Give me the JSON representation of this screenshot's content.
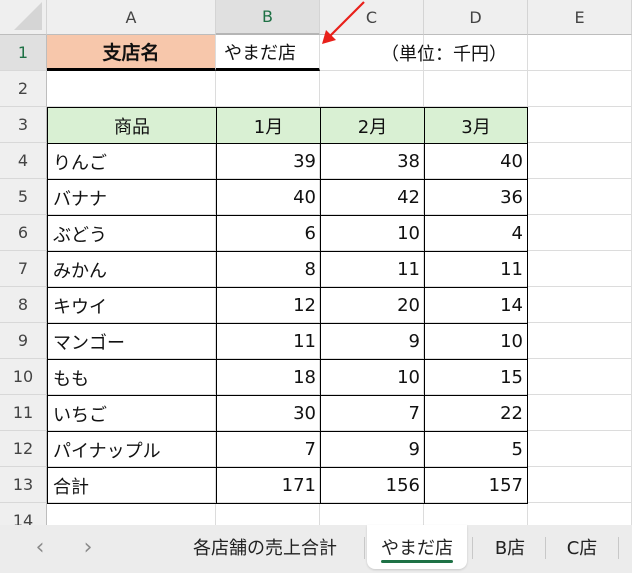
{
  "columns": [
    {
      "label": "A",
      "selected": false
    },
    {
      "label": "B",
      "selected": true
    },
    {
      "label": "C",
      "selected": false
    },
    {
      "label": "D",
      "selected": false
    },
    {
      "label": "E",
      "selected": false
    }
  ],
  "rows": [
    "1",
    "2",
    "3",
    "4",
    "5",
    "6",
    "7",
    "8",
    "9",
    "10",
    "11",
    "12",
    "13",
    "14"
  ],
  "selected_row": "1",
  "branch_label": "支店名",
  "branch_value": "やまだ店",
  "unit_note": "（単位：千円）",
  "table": {
    "headers": [
      "商品",
      "1月",
      "2月",
      "3月"
    ],
    "rows": [
      {
        "product": "りんご",
        "jan": "39",
        "feb": "38",
        "mar": "40"
      },
      {
        "product": "バナナ",
        "jan": "40",
        "feb": "42",
        "mar": "36"
      },
      {
        "product": "ぶどう",
        "jan": "6",
        "feb": "10",
        "mar": "4"
      },
      {
        "product": "みかん",
        "jan": "8",
        "feb": "11",
        "mar": "11"
      },
      {
        "product": "キウイ",
        "jan": "12",
        "feb": "20",
        "mar": "14"
      },
      {
        "product": "マンゴー",
        "jan": "11",
        "feb": "9",
        "mar": "10"
      },
      {
        "product": "もも",
        "jan": "18",
        "feb": "10",
        "mar": "15"
      },
      {
        "product": "いちご",
        "jan": "30",
        "feb": "7",
        "mar": "22"
      },
      {
        "product": "パイナップル",
        "jan": "7",
        "feb": "9",
        "mar": "5"
      },
      {
        "product": "合計",
        "jan": "171",
        "feb": "156",
        "mar": "157"
      }
    ]
  },
  "annotation": {
    "type": "arrow",
    "color": "#e8201a",
    "points_to": "B1"
  },
  "sheet_tabs": {
    "prev_icon": "‹",
    "next_icon": "›",
    "tabs": [
      {
        "label": "各店舗の売上合計",
        "active": false
      },
      {
        "label": "やまだ店",
        "active": true
      },
      {
        "label": "B店",
        "active": false
      },
      {
        "label": "C店",
        "active": false
      }
    ]
  },
  "colors": {
    "branch_header_bg": "#f7c7ab",
    "table_header_bg": "#d9f0d3",
    "accent_green": "#1e7145"
  }
}
